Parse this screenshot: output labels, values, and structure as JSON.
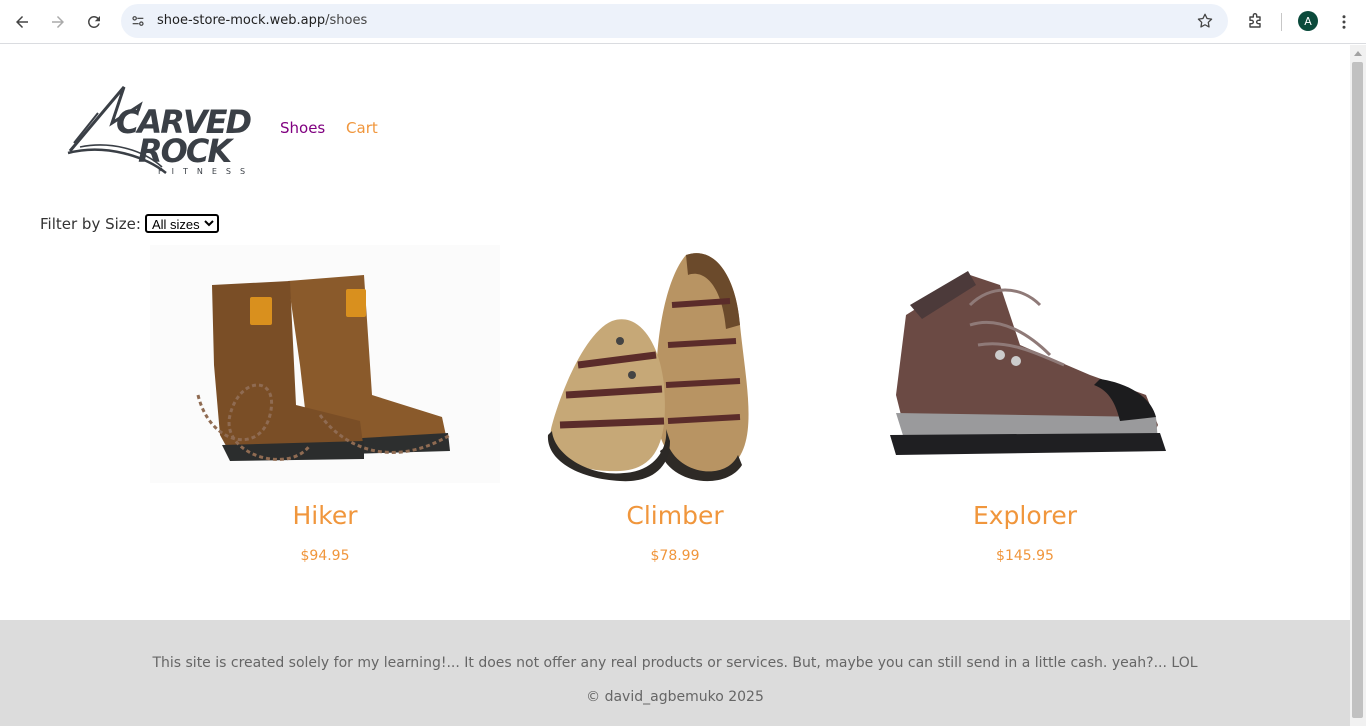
{
  "browser": {
    "url_host": "shoe-store-mock.web.app",
    "url_path": "/shoes",
    "avatar_letter": "A"
  },
  "header": {
    "logo_text": "CARVED ROCK FITNESS",
    "nav": [
      {
        "label": "Shoes",
        "color": "#800080"
      },
      {
        "label": "Cart",
        "color": "#f0963c"
      }
    ]
  },
  "filter": {
    "label": "Filter by Size:",
    "selected": "All sizes"
  },
  "products": [
    {
      "name": "Hiker",
      "price": "$94.95",
      "icon": "hiking-boots-image"
    },
    {
      "name": "Climber",
      "price": "$78.99",
      "icon": "sandals-image"
    },
    {
      "name": "Explorer",
      "price": "$145.95",
      "icon": "hiking-boot-image"
    }
  ],
  "footer": {
    "note": "This site is created solely for my learning!... It does not offer any real products or services. But, maybe you can still send in a little cash. yeah?... LOL",
    "copyright": "© david_agbemuko 2025"
  },
  "colors": {
    "accent": "#f0963c",
    "visited_link": "#800080",
    "footer_bg": "#dcdcdc"
  }
}
